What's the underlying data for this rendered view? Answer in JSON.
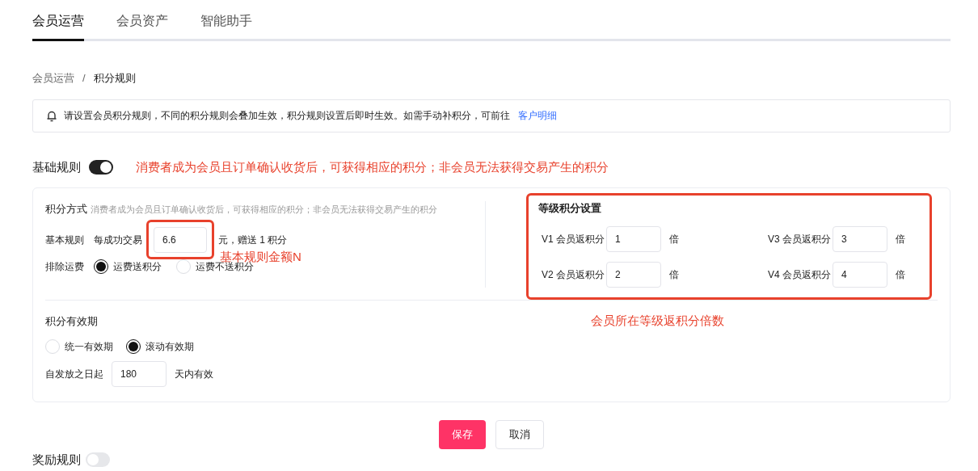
{
  "tabs": [
    {
      "label": "会员运营",
      "selected": true
    },
    {
      "label": "会员资产",
      "selected": false
    },
    {
      "label": "智能助手",
      "selected": false
    }
  ],
  "breadcrumb": [
    {
      "label": "会员运营"
    },
    {
      "label": "积分规则"
    }
  ],
  "breadcrumb_separator": "/",
  "notice": {
    "text": "请设置会员积分规则，不同的积分规则会叠加生效，积分规则设置后即时生效。如需手动补积分，可前往",
    "link": "客户明细"
  },
  "basic_rule": {
    "title": "基础规则",
    "on": true,
    "annotation": "消费者成为会员且订单确认收货后，可获得相应的积分；非会员无法获得交易产生的积分",
    "points_method": {
      "label": "积分方式",
      "hint": "消费者成为会员且订单确认收货后，可获得相应的积分；非会员无法获得交易产生的积分",
      "rule_label": "基本规则",
      "prefix": "每成功交易",
      "amount": "6.6",
      "suffix": "元，赠送 1 积分",
      "annotation": "基本规则金额N"
    },
    "shipping": {
      "label": "排除运费",
      "options": [
        {
          "label": "运费送积分",
          "selected": true
        },
        {
          "label": "运费不送积分",
          "selected": false
        }
      ]
    },
    "level_settings": {
      "title": "等级积分设置",
      "annotation": "会员所在等级返积分倍数",
      "levels": [
        {
          "label": "V1 会员返积分",
          "value": "1",
          "unit": "倍"
        },
        {
          "label": "V3 会员返积分",
          "value": "3",
          "unit": "倍"
        },
        {
          "label": "V2 会员返积分",
          "value": "2",
          "unit": "倍"
        },
        {
          "label": "V4 会员返积分",
          "value": "4",
          "unit": "倍"
        }
      ]
    },
    "validity": {
      "title": "积分有效期",
      "options": [
        {
          "label": "统一有效期",
          "selected": false
        },
        {
          "label": "滚动有效期",
          "selected": true
        }
      ],
      "prefix": "自发放之日起",
      "days": "180",
      "suffix": "天内有效"
    }
  },
  "buttons": [
    {
      "label": "保存",
      "kind": "primary"
    },
    {
      "label": "取消",
      "kind": "secondary"
    }
  ],
  "reward_rule": {
    "title": "奖励规则",
    "on": false
  }
}
